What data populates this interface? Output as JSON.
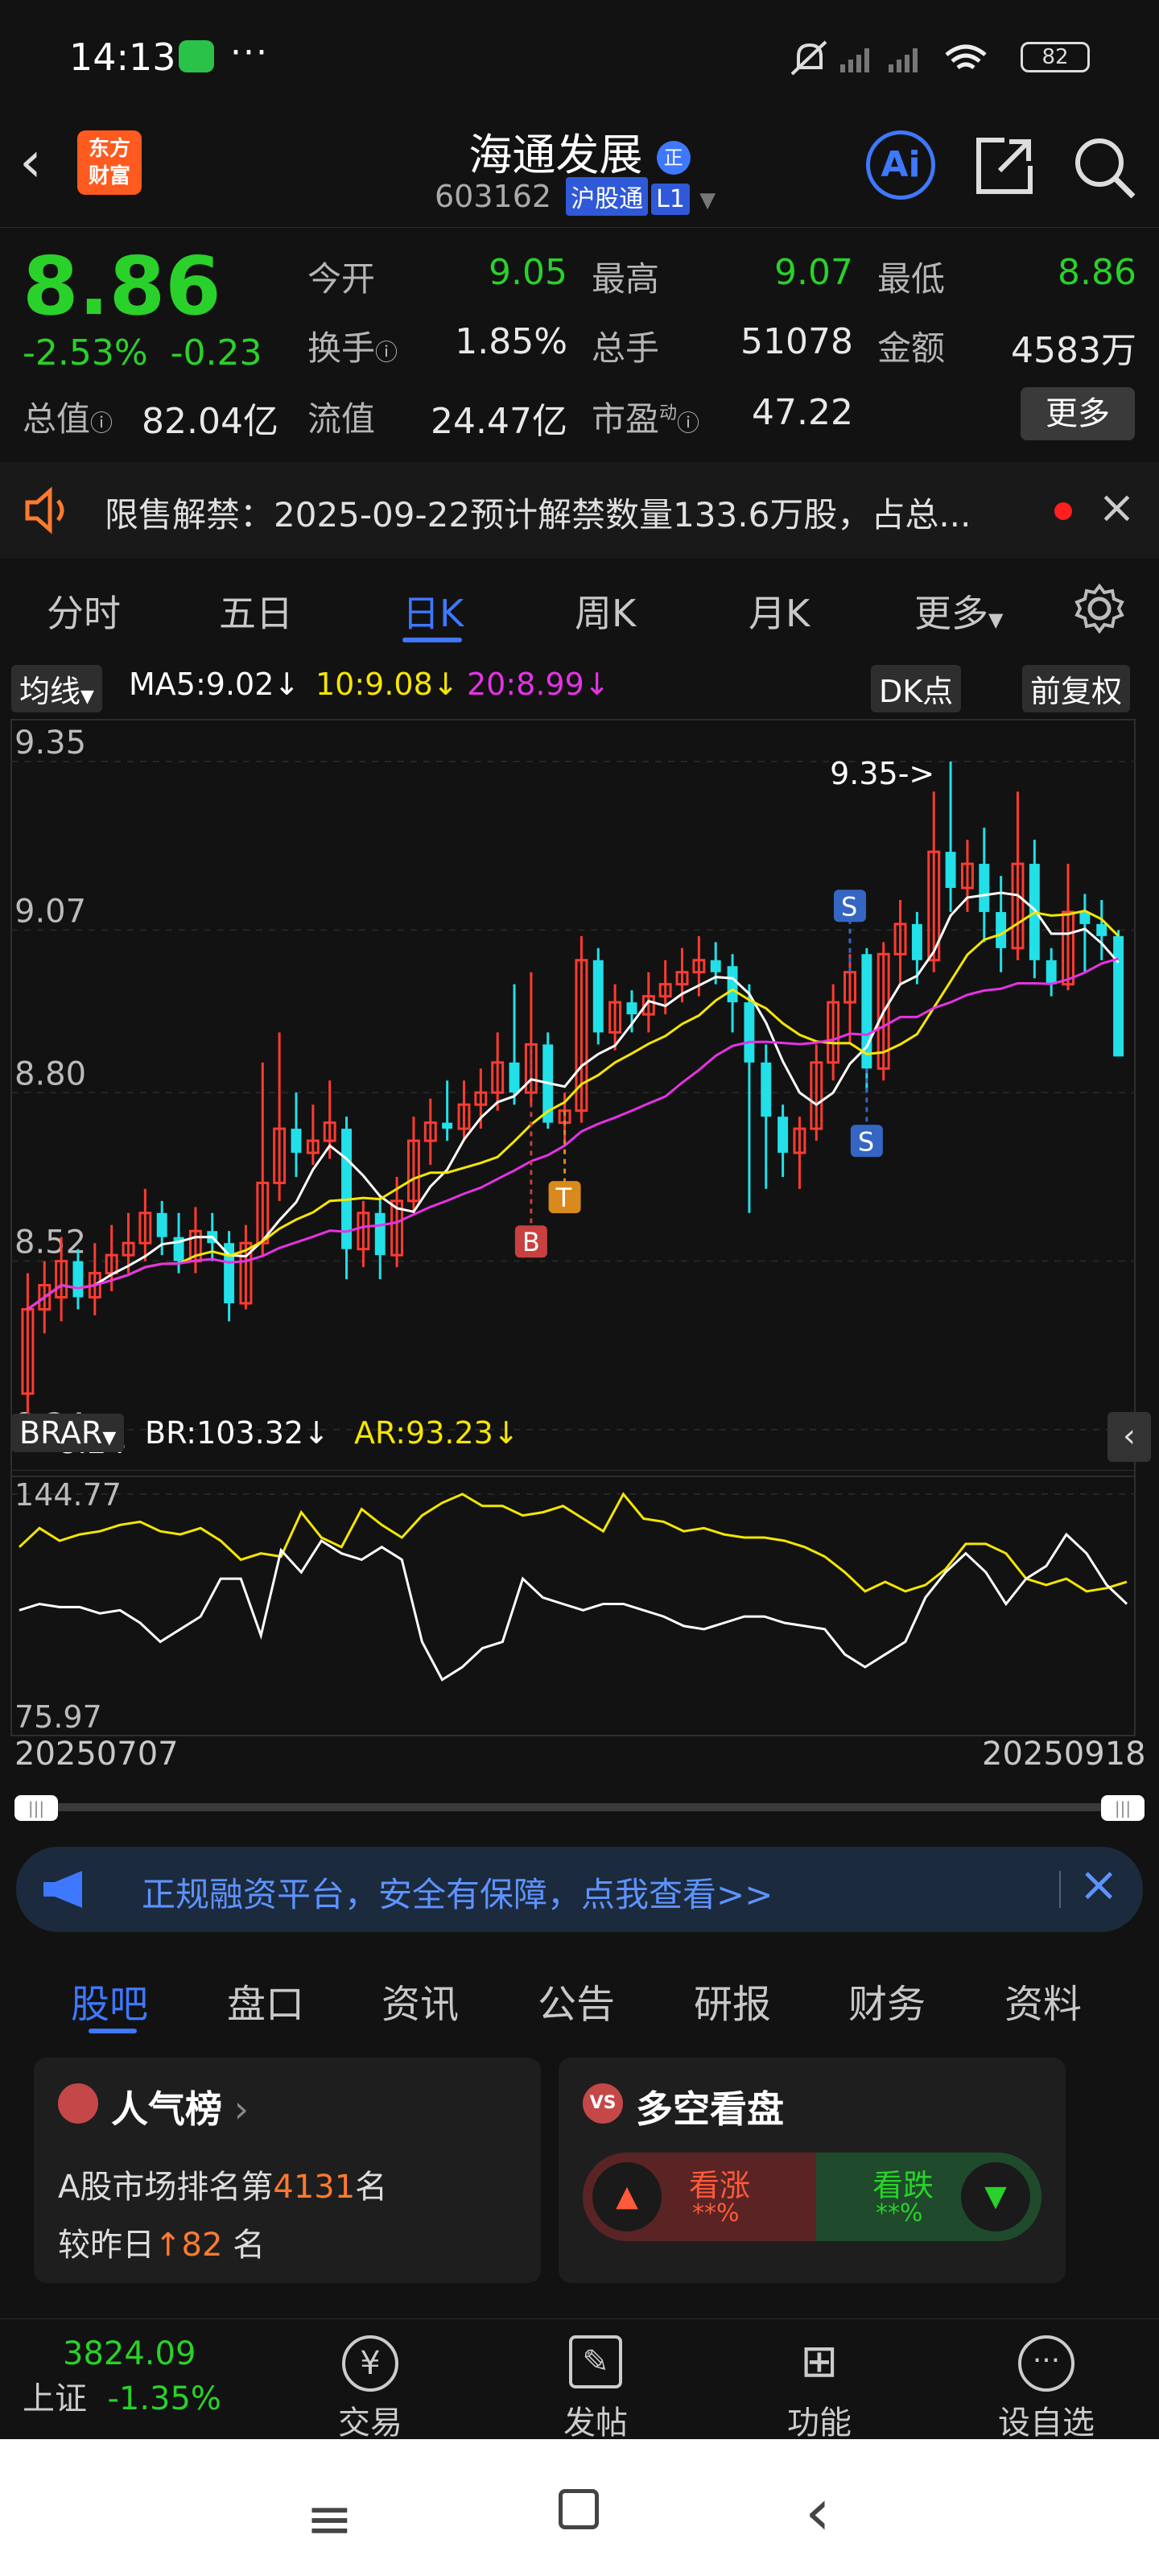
{
  "status": {
    "time": "14:13",
    "dots": "···",
    "battery": "82"
  },
  "header": {
    "name": "海通发展",
    "name_badge": "正",
    "code": "603162",
    "tag1": "沪股通",
    "tag2": "L1",
    "logo_line1": "东方",
    "logo_line2": "财富",
    "ai_label": "Ai"
  },
  "quote": {
    "price": "8.86",
    "pct": "-2.53%",
    "change": "-0.23",
    "today_open_label": "今开",
    "today_open": "9.05",
    "high_label": "最高",
    "high": "9.07",
    "low_label": "最低",
    "low": "8.86",
    "turnover_label": "换手",
    "turnover": "1.85%",
    "volume_label": "总手",
    "volume": "51078",
    "amount_label": "金额",
    "amount": "4583万",
    "mktcap_label": "总值",
    "mktcap": "82.04亿",
    "float_label": "流值",
    "float": "24.47亿",
    "pe_label": "市盈",
    "pe_sup": "动",
    "pe": "47.22",
    "more": "更多"
  },
  "notice": {
    "text": "限售解禁：2025-09-22预计解禁数量133.6万股，占总..."
  },
  "ktabs": [
    "分时",
    "五日",
    "日K",
    "周K",
    "月K",
    "更多"
  ],
  "chart_data": {
    "type": "candlestick",
    "indicator_bar": {
      "select": "均线",
      "ma5": "MA5:9.02",
      "ma10": "10:9.08",
      "ma20": "20:8.99",
      "dk": "DK点",
      "adjust": "前复权"
    },
    "y_ticks": [
      "9.35",
      "9.07",
      "8.80",
      "8.52",
      "8.24"
    ],
    "ylim": [
      8.24,
      9.35
    ],
    "high_marker": "9.35->",
    "low_marker": "<-8.24",
    "candles": [
      {
        "o": 8.3,
        "c": 8.44,
        "h": 8.5,
        "l": 8.26
      },
      {
        "o": 8.44,
        "c": 8.48,
        "h": 8.52,
        "l": 8.4
      },
      {
        "o": 8.46,
        "c": 8.52,
        "h": 8.56,
        "l": 8.42
      },
      {
        "o": 8.52,
        "c": 8.46,
        "h": 8.54,
        "l": 8.44
      },
      {
        "o": 8.46,
        "c": 8.5,
        "h": 8.55,
        "l": 8.43
      },
      {
        "o": 8.5,
        "c": 8.53,
        "h": 8.58,
        "l": 8.47
      },
      {
        "o": 8.53,
        "c": 8.55,
        "h": 8.6,
        "l": 8.5
      },
      {
        "o": 8.55,
        "c": 8.6,
        "h": 8.64,
        "l": 8.52
      },
      {
        "o": 8.6,
        "c": 8.56,
        "h": 8.62,
        "l": 8.53
      },
      {
        "o": 8.56,
        "c": 8.52,
        "h": 8.6,
        "l": 8.5
      },
      {
        "o": 8.52,
        "c": 8.57,
        "h": 8.61,
        "l": 8.5
      },
      {
        "o": 8.57,
        "c": 8.55,
        "h": 8.6,
        "l": 8.52
      },
      {
        "o": 8.55,
        "c": 8.45,
        "h": 8.57,
        "l": 8.42
      },
      {
        "o": 8.45,
        "c": 8.55,
        "h": 8.58,
        "l": 8.44
      },
      {
        "o": 8.55,
        "c": 8.65,
        "h": 8.85,
        "l": 8.53
      },
      {
        "o": 8.65,
        "c": 8.74,
        "h": 8.9,
        "l": 8.62
      },
      {
        "o": 8.74,
        "c": 8.7,
        "h": 8.8,
        "l": 8.66
      },
      {
        "o": 8.7,
        "c": 8.72,
        "h": 8.78,
        "l": 8.68
      },
      {
        "o": 8.72,
        "c": 8.75,
        "h": 8.82,
        "l": 8.69
      },
      {
        "o": 8.74,
        "c": 8.54,
        "h": 8.76,
        "l": 8.49
      },
      {
        "o": 8.54,
        "c": 8.6,
        "h": 8.62,
        "l": 8.51
      },
      {
        "o": 8.6,
        "c": 8.53,
        "h": 8.63,
        "l": 8.49
      },
      {
        "o": 8.53,
        "c": 8.62,
        "h": 8.66,
        "l": 8.51
      },
      {
        "o": 8.62,
        "c": 8.72,
        "h": 8.76,
        "l": 8.6
      },
      {
        "o": 8.72,
        "c": 8.75,
        "h": 8.79,
        "l": 8.68
      },
      {
        "o": 8.75,
        "c": 8.74,
        "h": 8.82,
        "l": 8.72
      },
      {
        "o": 8.74,
        "c": 8.78,
        "h": 8.82,
        "l": 8.72
      },
      {
        "o": 8.78,
        "c": 8.8,
        "h": 8.84,
        "l": 8.74
      },
      {
        "o": 8.8,
        "c": 8.85,
        "h": 8.9,
        "l": 8.77
      },
      {
        "o": 8.85,
        "c": 8.8,
        "h": 8.98,
        "l": 8.78
      },
      {
        "o": 8.8,
        "c": 8.88,
        "h": 9.0,
        "l": 8.78
      },
      {
        "o": 8.88,
        "c": 8.75,
        "h": 8.9,
        "l": 8.74
      },
      {
        "o": 8.75,
        "c": 8.77,
        "h": 8.8,
        "l": 8.72
      },
      {
        "o": 8.77,
        "c": 9.02,
        "h": 9.06,
        "l": 8.75
      },
      {
        "o": 9.02,
        "c": 8.9,
        "h": 9.04,
        "l": 8.88
      },
      {
        "o": 8.9,
        "c": 8.95,
        "h": 8.98,
        "l": 8.87
      },
      {
        "o": 8.95,
        "c": 8.93,
        "h": 8.97,
        "l": 8.9
      },
      {
        "o": 8.93,
        "c": 8.96,
        "h": 9.0,
        "l": 8.9
      },
      {
        "o": 8.96,
        "c": 8.98,
        "h": 9.02,
        "l": 8.93
      },
      {
        "o": 8.98,
        "c": 9.0,
        "h": 9.04,
        "l": 8.95
      },
      {
        "o": 9.0,
        "c": 9.02,
        "h": 9.06,
        "l": 8.96
      },
      {
        "o": 9.02,
        "c": 9.0,
        "h": 9.05,
        "l": 8.98
      },
      {
        "o": 9.01,
        "c": 8.95,
        "h": 9.03,
        "l": 8.9
      },
      {
        "o": 8.95,
        "c": 8.85,
        "h": 8.98,
        "l": 8.6
      },
      {
        "o": 8.85,
        "c": 8.76,
        "h": 8.88,
        "l": 8.64
      },
      {
        "o": 8.76,
        "c": 8.7,
        "h": 8.78,
        "l": 8.66
      },
      {
        "o": 8.7,
        "c": 8.74,
        "h": 8.76,
        "l": 8.64
      },
      {
        "o": 8.74,
        "c": 8.85,
        "h": 8.88,
        "l": 8.72
      },
      {
        "o": 8.85,
        "c": 8.95,
        "h": 8.98,
        "l": 8.82
      },
      {
        "o": 8.95,
        "c": 9.0,
        "h": 9.03,
        "l": 8.88
      },
      {
        "o": 9.03,
        "c": 8.84,
        "h": 9.04,
        "l": 8.8
      },
      {
        "o": 8.84,
        "c": 9.03,
        "h": 9.05,
        "l": 8.82
      },
      {
        "o": 9.03,
        "c": 9.08,
        "h": 9.12,
        "l": 8.98
      },
      {
        "o": 9.08,
        "c": 9.02,
        "h": 9.1,
        "l": 8.98
      },
      {
        "o": 9.02,
        "c": 9.2,
        "h": 9.3,
        "l": 9.0
      },
      {
        "o": 9.2,
        "c": 9.14,
        "h": 9.35,
        "l": 9.1
      },
      {
        "o": 9.14,
        "c": 9.18,
        "h": 9.22,
        "l": 9.1
      },
      {
        "o": 9.18,
        "c": 9.1,
        "h": 9.24,
        "l": 9.05
      },
      {
        "o": 9.1,
        "c": 9.04,
        "h": 9.16,
        "l": 9.0
      },
      {
        "o": 9.04,
        "c": 9.18,
        "h": 9.3,
        "l": 9.02
      },
      {
        "o": 9.18,
        "c": 9.02,
        "h": 9.22,
        "l": 8.99
      },
      {
        "o": 9.02,
        "c": 8.98,
        "h": 9.04,
        "l": 8.96
      },
      {
        "o": 8.98,
        "c": 9.1,
        "h": 9.18,
        "l": 8.97
      },
      {
        "o": 9.1,
        "c": 9.08,
        "h": 9.13,
        "l": 9.0
      },
      {
        "o": 9.08,
        "c": 9.06,
        "h": 9.12,
        "l": 9.02
      },
      {
        "o": 9.06,
        "c": 8.86,
        "h": 9.07,
        "l": 8.86
      }
    ],
    "signals": [
      {
        "label": "B",
        "index": 30
      },
      {
        "label": "T",
        "index": 32
      },
      {
        "label": "S",
        "index": 49
      },
      {
        "label": "S",
        "index": 50
      }
    ],
    "sub_indicator": {
      "select": "BRAR",
      "br": "BR:103.32",
      "ar": "AR:93.23",
      "y_max": "144.77",
      "y_min": "75.97",
      "ylim": [
        75.97,
        144.77
      ]
    },
    "ar_series": [
      128,
      134,
      130,
      132,
      133,
      135,
      136,
      133,
      132,
      134,
      130,
      124,
      126,
      125,
      139,
      131,
      128,
      140,
      135,
      131,
      138,
      142,
      146,
      141,
      141,
      138,
      139,
      141,
      137,
      133,
      146,
      137,
      136,
      133,
      134,
      132,
      131,
      131,
      130,
      128,
      125,
      120,
      114,
      117,
      114,
      116,
      121,
      129,
      129,
      126,
      118,
      116,
      118,
      114,
      115,
      117
    ],
    "br_series": [
      108,
      110,
      109,
      109,
      107,
      108,
      104,
      98,
      102,
      106,
      118,
      118,
      100,
      127,
      120,
      130,
      126,
      124,
      128,
      124,
      98,
      86,
      90,
      96,
      98,
      118,
      112,
      110,
      108,
      110,
      110,
      108,
      106,
      103,
      102,
      104,
      106,
      106,
      104,
      103,
      102,
      94,
      90,
      94,
      98,
      112,
      120,
      126,
      120,
      110,
      118,
      122,
      132,
      126,
      116,
      110
    ],
    "x_start": "20250707",
    "x_end": "20250918"
  },
  "ad": {
    "text": "正规融资平台，安全有保障，点我查看>>"
  },
  "stabs": [
    "股吧",
    "盘口",
    "资讯",
    "公告",
    "研报",
    "财务",
    "资料"
  ],
  "popularity": {
    "title": "人气榜",
    "rank_prefix": "A股市场排名第",
    "rank": "4131",
    "rank_suffix": "名",
    "compare_prefix": "较昨日",
    "compare": "82",
    "compare_suffix": "名"
  },
  "longshort": {
    "title": "多空看盘",
    "up_label": "看涨",
    "up_value": "**%",
    "down_label": "看跌",
    "down_value": "**%"
  },
  "bottomnav": {
    "index_value": "3824.09",
    "index_name": "上证",
    "index_pct": "-1.35%",
    "trade": "交易",
    "post": "发帖",
    "func": "功能",
    "watch": "设自选"
  },
  "colors": {
    "up": "#ff3b30",
    "down": "#2ad12a",
    "accent": "#3e78ff",
    "candle_down": "#22e0e8",
    "ma5": "#ffffff",
    "ma10": "#f5e600",
    "ma20": "#e533e5"
  }
}
